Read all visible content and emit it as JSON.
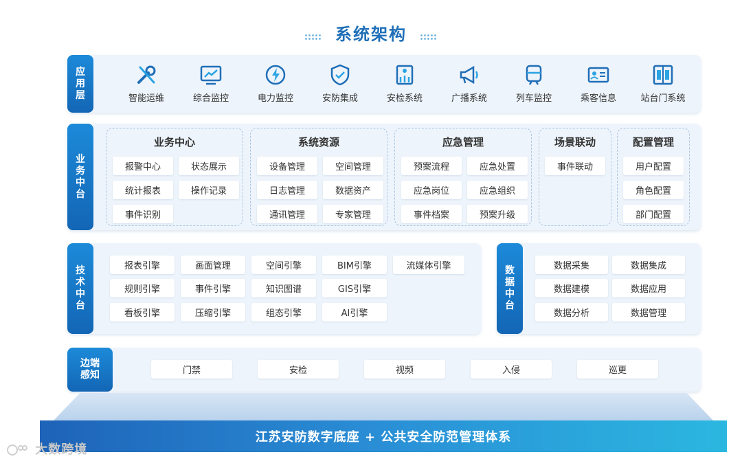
{
  "title": "系统架构",
  "layers": {
    "application": {
      "tag": "应用层",
      "items": [
        {
          "label": "智能运维",
          "icon": "wrench-icon"
        },
        {
          "label": "综合监控",
          "icon": "monitor-chart-icon"
        },
        {
          "label": "电力监控",
          "icon": "lightning-icon"
        },
        {
          "label": "安防集成",
          "icon": "shield-icon"
        },
        {
          "label": "安检系统",
          "icon": "security-check-icon"
        },
        {
          "label": "广播系统",
          "icon": "megaphone-icon"
        },
        {
          "label": "列车监控",
          "icon": "train-icon"
        },
        {
          "label": "乘客信息",
          "icon": "passenger-info-icon"
        },
        {
          "label": "站台门系统",
          "icon": "platform-door-icon"
        }
      ]
    },
    "business": {
      "tag": "业务中台",
      "groups": [
        {
          "title": "业务中心",
          "items": [
            "报警中心",
            "状态展示",
            "统计报表",
            "操作记录",
            "事件识别"
          ]
        },
        {
          "title": "系统资源",
          "items": [
            "设备管理",
            "空间管理",
            "日志管理",
            "数据资产",
            "通讯管理",
            "专家管理"
          ]
        },
        {
          "title": "应急管理",
          "items": [
            "预案流程",
            "应急处置",
            "应急岗位",
            "应急组织",
            "事件档案",
            "预案升级"
          ]
        },
        {
          "title": "场景联动",
          "items": [
            "事件联动"
          ]
        },
        {
          "title": "配置管理",
          "items": [
            "用户配置",
            "角色配置",
            "部门配置"
          ]
        }
      ]
    },
    "tech": {
      "tag": "技术中台",
      "items": [
        "报表引擎",
        "画面管理",
        "空间引擎",
        "BIM引擎",
        "流媒体引擎",
        "规则引擎",
        "事件引擎",
        "知识图谱",
        "GIS引擎",
        "看板引擎",
        "压缩引擎",
        "组态引擎",
        "AI引擎"
      ]
    },
    "data": {
      "tag": "数据中台",
      "items": [
        "数据采集",
        "数据集成",
        "数据建模",
        "数据应用",
        "数据分析",
        "数据管理"
      ]
    },
    "edge": {
      "tag": "边端感知",
      "items": [
        "门禁",
        "安检",
        "视频",
        "入侵",
        "巡更"
      ]
    }
  },
  "base": "江苏安防数字底座 + 公共安全防范管理体系",
  "watermark": "大数跨境",
  "colors": {
    "primary": "#1c7fd1",
    "title": "#1f6fb8",
    "panel": "#eef4fb"
  }
}
